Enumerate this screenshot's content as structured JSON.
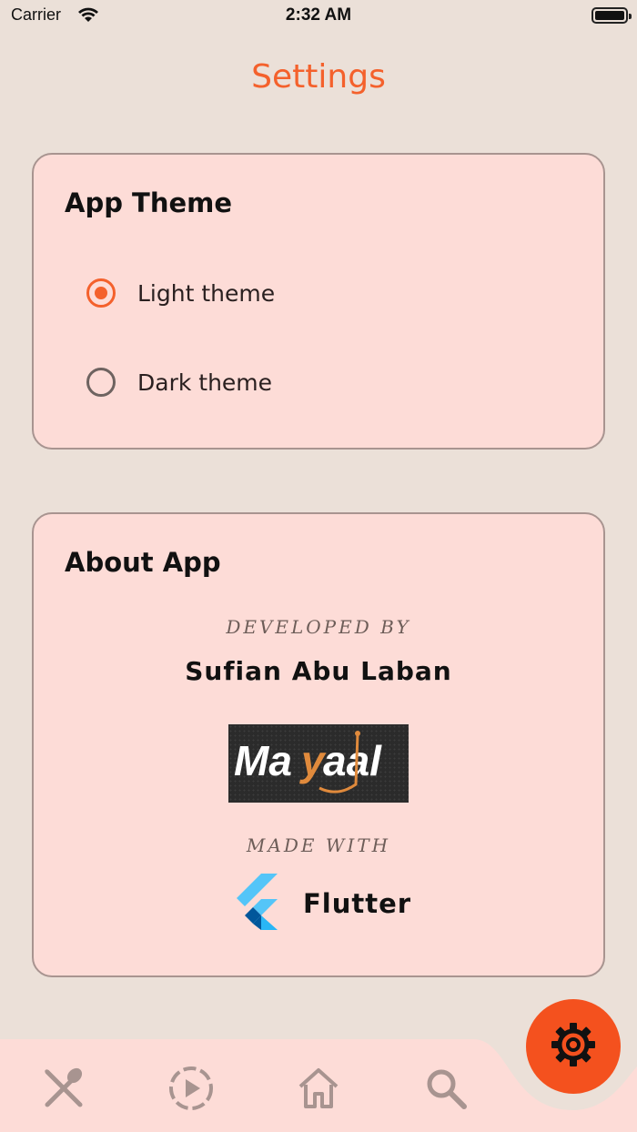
{
  "status_bar": {
    "carrier": "Carrier",
    "time": "2:32 AM"
  },
  "header": {
    "title": "Settings"
  },
  "theme_card": {
    "title": "App Theme",
    "options": [
      {
        "label": "Light theme",
        "selected": true
      },
      {
        "label": "Dark theme",
        "selected": false
      }
    ]
  },
  "about_card": {
    "title": "About App",
    "developed_by_label": "DEVELOPED BY",
    "developer_name": "Sufian Abu Laban",
    "logo_text": "Mayaal",
    "made_with_label": "MADE WITH",
    "framework_name": "Flutter"
  },
  "bottom_nav": {
    "items": [
      {
        "icon": "fork-spoon-icon"
      },
      {
        "icon": "play-circle-icon"
      },
      {
        "icon": "home-icon"
      },
      {
        "icon": "search-icon"
      }
    ],
    "active_icon": "gear-icon"
  },
  "colors": {
    "accent": "#f4612c",
    "background": "#ebe0d8",
    "card": "#fddcd7",
    "nav": "#fddcd7"
  }
}
